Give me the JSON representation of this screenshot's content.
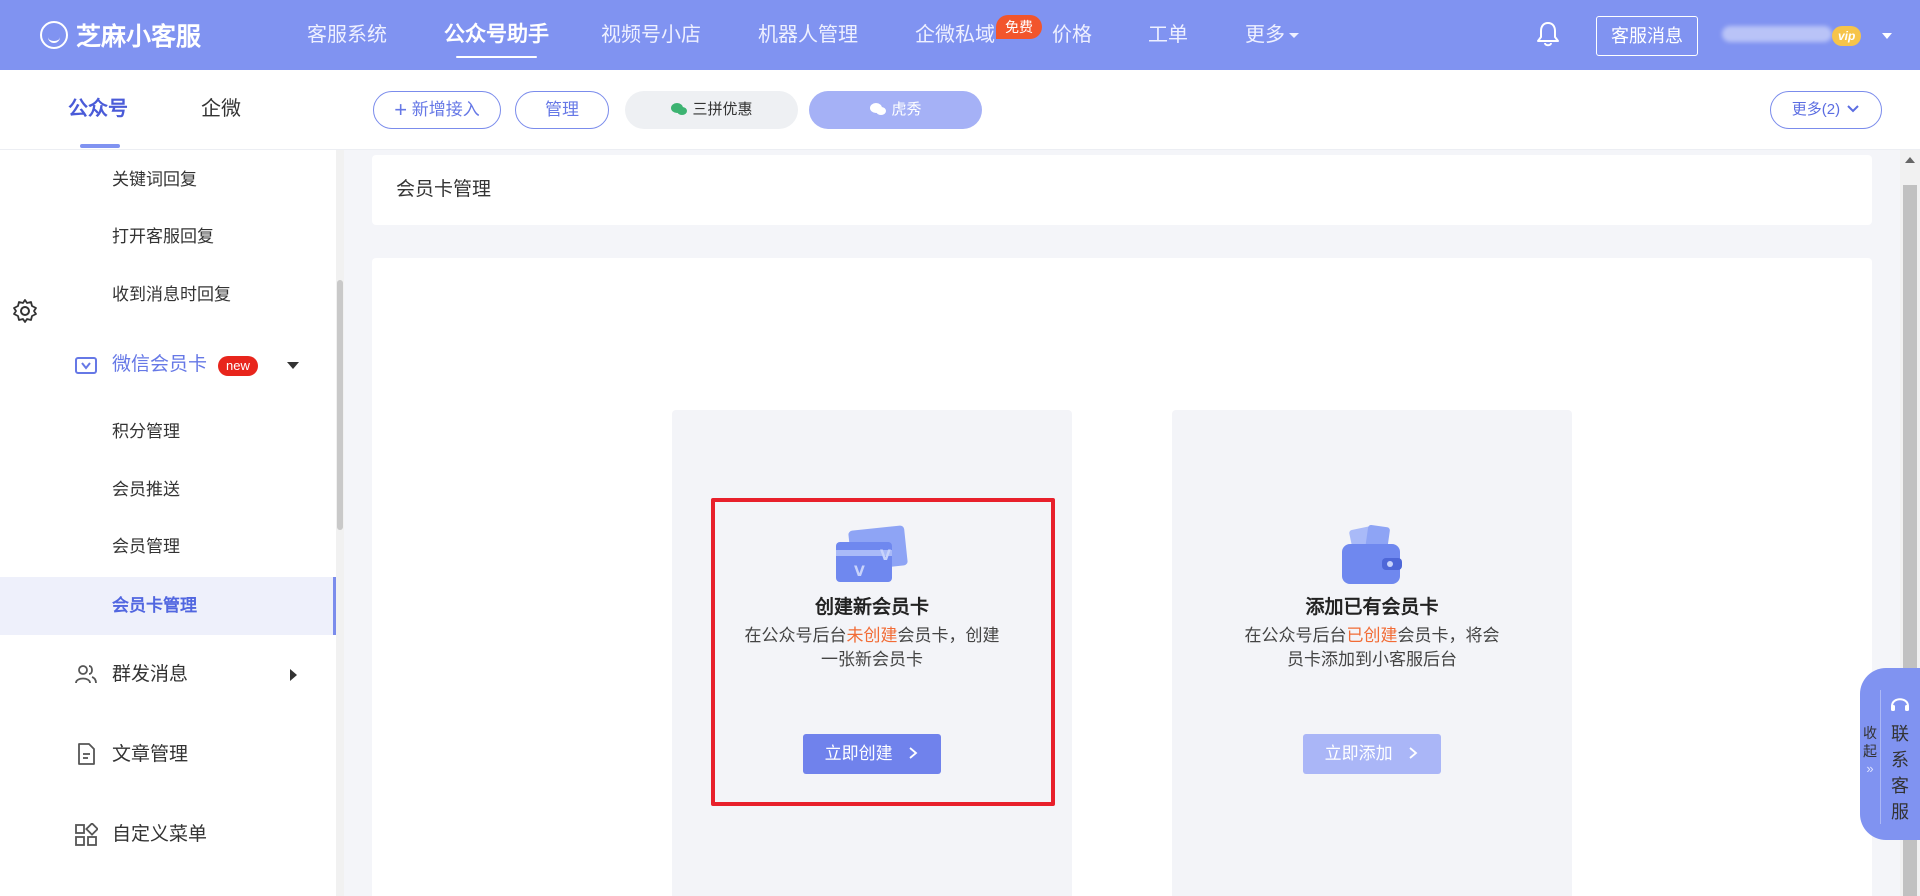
{
  "brand": {
    "name": "芝麻小客服"
  },
  "topnav": {
    "items": [
      "客服系统",
      "公众号助手",
      "视频号小店",
      "机器人管理",
      "企微私域",
      "价格",
      "工单",
      "更多"
    ],
    "free_badge": "免费",
    "message_button": "客服消息",
    "vip_label": "vip"
  },
  "subnav": {
    "tabs": [
      "公众号",
      "企微"
    ],
    "add_button": "新增接入",
    "manage_button": "管理",
    "accounts": [
      "三拼优惠",
      "虎秀"
    ],
    "more_button": "更多(2)"
  },
  "sidebar": {
    "reply_items": [
      "关键词回复",
      "打开客服回复",
      "收到消息时回复"
    ],
    "member_section": {
      "label": "微信会员卡",
      "badge": "new"
    },
    "member_items": [
      "积分管理",
      "会员推送",
      "会员管理",
      "会员卡管理"
    ],
    "sections": [
      "群发消息",
      "文章管理",
      "自定义菜单"
    ]
  },
  "main": {
    "breadcrumb": "会员卡管理",
    "create_card": {
      "title": "创建新会员卡",
      "desc_pre": "在公众号后台",
      "desc_highlight": "未创建",
      "desc_mid": "会员卡，创建",
      "desc_line2": "一张新会员卡",
      "button": "立即创建"
    },
    "add_card": {
      "title": "添加已有会员卡",
      "desc_pre": "在公众号后台",
      "desc_highlight": "已创建",
      "desc_mid": "会员卡，将会",
      "desc_line2": "员卡添加到小客服后台",
      "button": "立即添加"
    }
  },
  "float": {
    "collapse": "收起",
    "contact": [
      "联",
      "系",
      "客",
      "服"
    ]
  },
  "colors": {
    "accent": "#8093f1",
    "highlight": "#f26b35",
    "frame": "#e8202b"
  }
}
